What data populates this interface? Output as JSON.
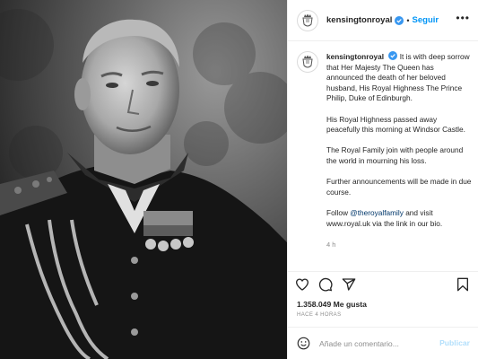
{
  "account": {
    "username": "kensingtonroyal",
    "verified": true,
    "separator": "•",
    "follow_label": "Seguir",
    "avatar_icon": "royal-crest-icon"
  },
  "photo": {
    "description_icon": "portrait-photo",
    "tone": "black-and-white"
  },
  "caption": {
    "username": "kensingtonroyal",
    "paragraph_1": "It is with deep sorrow that Her Majesty The Queen has announced the death of her beloved husband, His Royal Highness The Prince Philip, Duke of Edinburgh.",
    "paragraph_2": "His Royal Highness passed away peacefully this morning at Windsor Castle.",
    "paragraph_3": "The Royal Family join with people around the world in mourning his loss.",
    "paragraph_4": "Further announcements will be made in due course.",
    "paragraph_5_prefix": "Follow ",
    "mention": "@theroyalfamily",
    "paragraph_5_suffix": " and visit www.royal.uk via the link in our bio.",
    "time": "4 h"
  },
  "actions": {
    "icons": [
      "heart-icon",
      "comment-icon",
      "share-icon",
      "bookmark-icon"
    ]
  },
  "likes": {
    "text": "1.358.049 Me gusta"
  },
  "timestamp": {
    "text": "HACE 4 HORAS"
  },
  "comment": {
    "placeholder": "Añade un comentario...",
    "publish_label": "Publicar"
  },
  "colors": {
    "accent": "#0095f6",
    "verified": "#3897f0",
    "publish_disabled": "#b2dffc",
    "border": "#efefef",
    "muted": "#8e8e8e"
  }
}
